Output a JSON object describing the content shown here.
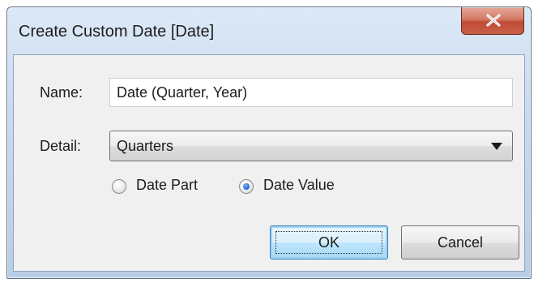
{
  "window": {
    "title": "Create Custom Date [Date]"
  },
  "form": {
    "name_label": "Name:",
    "name_value": "Date (Quarter, Year)",
    "detail_label": "Detail:",
    "detail_value": "Quarters"
  },
  "radios": [
    {
      "label": "Date Part",
      "checked": false
    },
    {
      "label": "Date Value",
      "checked": true
    }
  ],
  "buttons": {
    "ok": "OK",
    "cancel": "Cancel"
  },
  "icons": {
    "close": "close-icon",
    "dropdown": "chevron-down-icon"
  },
  "colors": {
    "close_button": "#c9604a",
    "title_bar": "#c9daee",
    "default_button": "#bee6fd"
  }
}
